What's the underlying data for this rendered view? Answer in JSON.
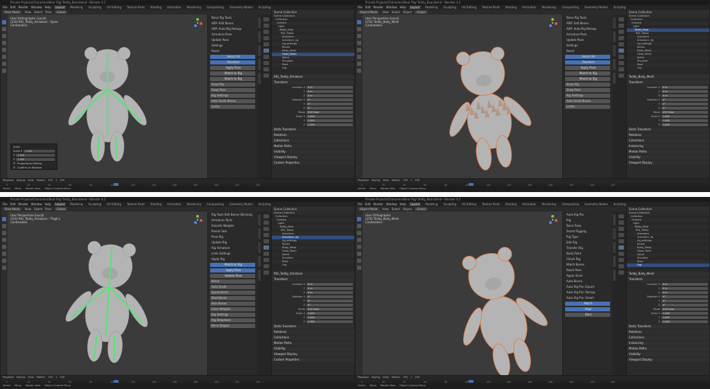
{
  "panes": [
    {
      "title": "Private Projects/Characters/Bear Rig/ Teddy_Bear.blend - Blender 4.2",
      "menu": [
        "File",
        "Edit",
        "Render",
        "Window",
        "Help"
      ],
      "workspaces": [
        "Layout",
        "Modeling",
        "Sculpting",
        "UV Editing",
        "Texture Paint",
        "Shading",
        "Animation",
        "Rendering",
        "Compositing",
        "Geometry Nodes",
        "Scripting"
      ],
      "active_workspace": "Layout",
      "header": {
        "mode": "Pose Mode",
        "view": "View",
        "select": "Select",
        "pose": "Pose",
        "pivot": "Global"
      },
      "viewport_info": [
        "User Orthographic (Local)",
        "(150) RIG_Teddy_Armature : Spine",
        "Centimeters"
      ],
      "npanel": {
        "rows": [
          "Bone Rig Tools",
          "ARP: Edit Bones",
          "ARP: Auto-Rig Remap",
          "Armature Pose",
          "Update Pose",
          "Settings",
          "Reset"
        ],
        "buttons": [
          "Select All",
          "Deselect",
          "Apply Pose",
          "Match to Rig",
          "Match to Rig"
        ],
        "bottom": [
          "Snap Rig",
          "Snap Pose",
          "Rig Settings",
          "Auto Scale Bones",
          "Limbs"
        ]
      },
      "outliner": {
        "header": "Scene Collection",
        "rows": [
          "Scene Collection",
          "Collection",
          "Camera",
          "Light",
          "Teddy_Bear",
          "RIG_Teddy",
          "Armature",
          "Armature_rig",
          "rig_settings",
          "Bones",
          "Body_Mesh",
          "Head_Mesh",
          "Spine",
          "Shoulder",
          "Root",
          "Leg"
        ],
        "selected": 11
      },
      "props": {
        "title": "RIG_Teddy_Armature",
        "section": "Transform",
        "rows": [
          [
            "Location X",
            "0 m"
          ],
          [
            "Y",
            "0 m"
          ],
          [
            "Z",
            "0 m"
          ],
          [
            "Rotation X",
            "0°"
          ],
          [
            "Y",
            "0°"
          ],
          [
            "Z",
            "0°"
          ],
          [
            "Mode",
            "XYZ Euler"
          ],
          [
            "Scale X",
            "1.000"
          ],
          [
            "Y",
            "1.000"
          ],
          [
            "Z",
            "1.000"
          ]
        ],
        "sections": [
          "Delta Transform",
          "Relations",
          "Collections",
          "Motion Paths",
          "Visibility",
          "Viewport Display",
          "Custom Properties"
        ]
      },
      "op_panel": {
        "title": "Scale",
        "rows": [
          [
            "Scale X",
            "1.000"
          ],
          [
            "Y",
            "1.000"
          ],
          [
            "Z",
            "1.000"
          ]
        ],
        "checks": [
          "Proportional Editing",
          "Confirm on Release"
        ]
      },
      "timeline": {
        "labels": [
          "Playback",
          "Keying",
          "View",
          "Marker"
        ],
        "frame": "150",
        "start": "1",
        "end": "250",
        "ticks": [
          "0",
          "20",
          "40",
          "60",
          "80",
          "100",
          "120",
          "140",
          "160",
          "180",
          "200",
          "220",
          "240"
        ]
      },
      "status": [
        "Select",
        "Move",
        "Rotate View",
        "Object Context Menu"
      ]
    },
    {
      "title": "Private Projects/Characters/Bear Rig/ Teddy_Bear.blend - Blender 4.2",
      "menu": [
        "File",
        "Edit",
        "Render",
        "Window",
        "Help"
      ],
      "workspaces": [
        "Layout",
        "Modeling",
        "Sculpting",
        "UV Editing",
        "Texture Paint",
        "Shading",
        "Animation",
        "Rendering",
        "Compositing",
        "Geometry Nodes",
        "Scripting"
      ],
      "active_workspace": "Layout",
      "header": {
        "mode": "Object Mode",
        "view": "View",
        "select": "Select",
        "pose": "Object",
        "pivot": "Global"
      },
      "viewport_info": [
        "User Perspective (Local)",
        "(150) Teddy_Body_Mesh",
        "Centimeters"
      ],
      "npanel": {
        "rows": [
          "Bone Rig Tools",
          "ARP: Edit Bones",
          "ARP: Auto-Rig Remap",
          "Armature Pose",
          "Update Pose",
          "Settings",
          "Reset"
        ],
        "buttons": [
          "Select All",
          "Deselect",
          "Apply Pose",
          "Match to Rig",
          "Match to Rig"
        ],
        "bottom": [
          "Snap Rig",
          "Snap Pose",
          "Rig Settings",
          "Auto Scale Bones",
          "Limbs"
        ]
      },
      "outliner": {
        "header": "Scene Collection",
        "rows": [
          "Scene Collection",
          "Collection",
          "Camera",
          "Light",
          "Teddy_Bear",
          "RIG_Teddy",
          "Armature",
          "Armature_rig",
          "rig_settings",
          "Bones",
          "Body_Mesh",
          "Head_Mesh",
          "Spine",
          "Shoulder",
          "Root",
          "Leg"
        ],
        "selected": 4
      },
      "props": {
        "title": "Teddy_Body_Mesh",
        "section": "Transform",
        "rows": [
          [
            "Location X",
            "0 m"
          ],
          [
            "Y",
            "0 m"
          ],
          [
            "Z",
            "0 m"
          ],
          [
            "Rotation X",
            "0°"
          ],
          [
            "Y",
            "0°"
          ],
          [
            "Z",
            "0°"
          ],
          [
            "Mode",
            "XYZ Euler"
          ],
          [
            "Scale X",
            "1.000"
          ],
          [
            "Y",
            "1.000"
          ],
          [
            "Z",
            "1.000"
          ]
        ],
        "sections": [
          "Delta Transform",
          "Relations",
          "Collections",
          "Instancing",
          "Motion Paths",
          "Visibility",
          "Viewport Display"
        ]
      },
      "timeline": {
        "labels": [
          "Playback",
          "Keying",
          "View",
          "Marker"
        ],
        "frame": "150",
        "start": "1",
        "end": "250",
        "ticks": [
          "0",
          "20",
          "40",
          "60",
          "80",
          "100",
          "120",
          "140",
          "160",
          "180",
          "200",
          "220",
          "240"
        ]
      },
      "status": [
        "Select",
        "Move",
        "Rotate View",
        "Object Context Menu"
      ]
    },
    {
      "title": "Private Projects/Characters/Bear Rig/ Teddy_Bear.blend - Blender 4.2",
      "menu": [
        "File",
        "Edit",
        "Render",
        "Window",
        "Help"
      ],
      "workspaces": [
        "Layout",
        "Modeling",
        "Sculpting",
        "UV Editing",
        "Texture Paint",
        "Shading",
        "Animation",
        "Rendering",
        "Compositing",
        "Geometry Nodes",
        "Scripting"
      ],
      "active_workspace": "Layout",
      "header": {
        "mode": "Pose Mode",
        "view": "View",
        "select": "Select",
        "pose": "Pose",
        "pivot": "Global"
      },
      "viewport_info": [
        "User Perspective (Local)",
        "(150) RIG_Teddy_Armature : Thigh.L",
        "Centimeters"
      ],
      "npanel": {
        "rows": [
          "Rig Tools Edit Bones Skinning",
          "Armature Tools",
          "Smooth Weights",
          "Parent Skin",
          "Pose Rig",
          "Update Rig",
          "Rig Armature",
          "Limb Settings",
          "Apply Rig"
        ],
        "buttons": [
          "Match to Rig",
          "Apply Pose",
          "Update Pose"
        ],
        "bottom": [
          "Mirror",
          "Auto Scale",
          "Symmetrize",
          "Bind Bones",
          "Skin Bones",
          "Clear Weights",
          "Rig Settings",
          "Rig Dropdown",
          "Bone Shapes"
        ]
      },
      "outliner": {
        "header": "Scene Collection",
        "rows": [
          "Scene Collection",
          "Collection",
          "Camera",
          "Light",
          "Teddy_Bear",
          "RIG_Teddy",
          "Armature",
          "Armature_rig",
          "rig_settings",
          "Bones",
          "Body_Mesh",
          "Head_Mesh",
          "Spine",
          "Shoulder",
          "Root",
          "Leg"
        ],
        "selected": 7
      },
      "props": {
        "title": "RIG_Teddy_Armature",
        "section": "Transform",
        "rows": [
          [
            "Location X",
            "0 m"
          ],
          [
            "Y",
            "0 m"
          ],
          [
            "Z",
            "0 m"
          ],
          [
            "Rotation X",
            "0°"
          ],
          [
            "Y",
            "0°"
          ],
          [
            "Z",
            "0°"
          ],
          [
            "Mode",
            "XYZ Euler"
          ],
          [
            "Scale X",
            "1.000"
          ],
          [
            "Y",
            "1.000"
          ],
          [
            "Z",
            "1.000"
          ]
        ],
        "sections": [
          "Delta Transform",
          "Relations",
          "Collections",
          "Motion Paths",
          "Visibility",
          "Viewport Display",
          "Custom Properties"
        ]
      },
      "timeline": {
        "labels": [
          "Playback",
          "Keying",
          "View",
          "Marker"
        ],
        "frame": "150",
        "start": "1",
        "end": "250",
        "ticks": [
          "0",
          "20",
          "40",
          "60",
          "80",
          "100",
          "120",
          "140",
          "160",
          "180",
          "200",
          "220",
          "240"
        ]
      },
      "status": [
        "Select",
        "Move",
        "Rotate View",
        "Object Context Menu"
      ]
    },
    {
      "title": "Private Projects/Characters/Bear Rig/ Teddy_Bear.blend - Blender 4.2",
      "menu": [
        "File",
        "Edit",
        "Render",
        "Window",
        "Help"
      ],
      "workspaces": [
        "Layout",
        "Modeling",
        "Sculpting",
        "UV Editing",
        "Texture Paint",
        "Shading",
        "Animation",
        "Rendering",
        "Compositing",
        "Geometry Nodes",
        "Scripting"
      ],
      "active_workspace": "Layout",
      "header": {
        "mode": "Object Mode",
        "view": "View",
        "select": "Select",
        "pose": "Object",
        "pivot": "Global"
      },
      "viewport_info": [
        "User Orthographic",
        "(150) Teddy_Body_Mesh",
        "Centimeters"
      ],
      "npanel": {
        "rows": [
          "Auto-Rig Pro",
          "Rig",
          "Bone Tools",
          "Smart Rigging",
          "Rig Type",
          "Edit Rig",
          "Transfer Rig",
          "Body Paint",
          "Check Rig",
          "Match Bones",
          "Reset Pose",
          "Apply Scale",
          "Auto Bones",
          "Auto Rig Pro: Export",
          "Auto Rig Pro: Remap",
          "Auto Rig Pro: Smart"
        ],
        "buttons": [
          "Match",
          "Align",
          "Bind"
        ],
        "bottom": []
      },
      "outliner": {
        "header": "Scene Collection",
        "rows": [
          "Scene Collection",
          "Collection",
          "Camera",
          "Light",
          "Teddy_Bear",
          "RIG_Teddy",
          "Armature",
          "Armature_rig",
          "rig_settings",
          "Bones",
          "Body_Mesh",
          "Head_Mesh",
          "Spine",
          "Shoulder",
          "Root",
          "Leg"
        ],
        "selected": 15
      },
      "props": {
        "title": "Teddy_Body_Mesh",
        "section": "Transform",
        "rows": [
          [
            "Location X",
            "0 m"
          ],
          [
            "Y",
            "0 m"
          ],
          [
            "Z",
            "0 m"
          ],
          [
            "Rotation X",
            "0°"
          ],
          [
            "Y",
            "0°"
          ],
          [
            "Z",
            "0°"
          ],
          [
            "Mode",
            "XYZ Euler"
          ],
          [
            "Scale X",
            "1.000"
          ],
          [
            "Y",
            "1.000"
          ],
          [
            "Z",
            "1.000"
          ]
        ],
        "sections": [
          "Delta Transform",
          "Relations",
          "Collections",
          "Instancing",
          "Motion Paths",
          "Visibility",
          "Viewport Display"
        ]
      },
      "timeline": {
        "labels": [
          "Playback",
          "Keying",
          "View",
          "Marker"
        ],
        "frame": "150",
        "start": "1",
        "end": "250",
        "ticks": [
          "0",
          "20",
          "40",
          "60",
          "80",
          "100",
          "120",
          "140",
          "160",
          "180",
          "200",
          "220",
          "240"
        ]
      },
      "status": [
        "Select",
        "Move",
        "Rotate View",
        "Object Context Menu"
      ]
    }
  ],
  "colors": {
    "accent": "#4772b3",
    "bone_green": "#5ee07a",
    "selection_orange": "#e8793a",
    "bg": "#303030"
  }
}
